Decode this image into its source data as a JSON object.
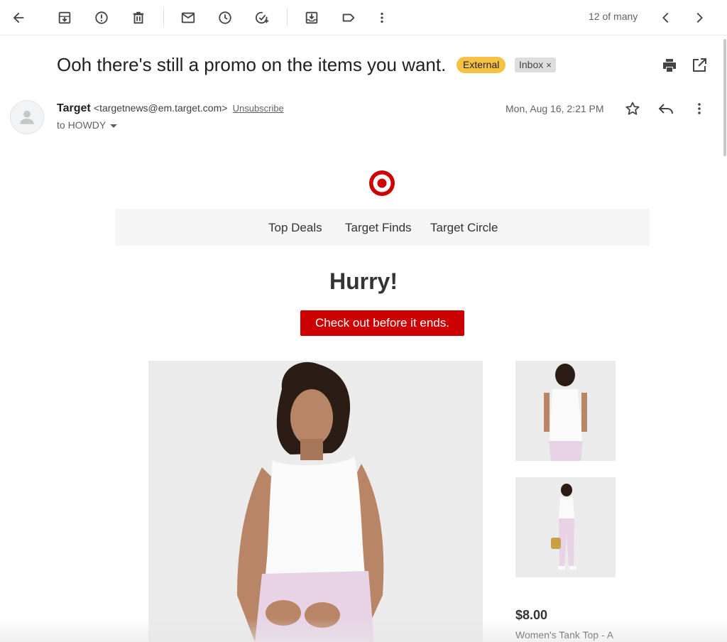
{
  "toolbar": {
    "pager_text": "12 of many",
    "icons": [
      "back-arrow-icon",
      "archive-icon",
      "report-spam-icon",
      "delete-icon",
      "mark-unread-icon",
      "snooze-icon",
      "add-task-icon",
      "move-to-icon",
      "label-icon",
      "more-vert-icon",
      "chevron-left-icon",
      "chevron-right-icon"
    ]
  },
  "email": {
    "subject": "Ooh there's still a promo on the items you want.",
    "labels": {
      "external": "External",
      "inbox": "Inbox",
      "inbox_remove": "×"
    },
    "sender_name": "Target",
    "sender_email": "<targetnews@em.target.com>",
    "unsubscribe": "Unsubscribe",
    "to": "to HOWDY",
    "date": "Mon, Aug 16, 2:21 PM"
  },
  "body": {
    "nav": [
      "Top Deals",
      "Target Finds",
      "Target Circle"
    ],
    "headline": "Hurry!",
    "cta": "Check out before it ends.",
    "price": "$8.00",
    "product_name": "Women's Tank Top - A"
  },
  "colors": {
    "brand_red": "#cc0000",
    "external_badge": "#f6c244",
    "inbox_badge": "#dddddd"
  }
}
